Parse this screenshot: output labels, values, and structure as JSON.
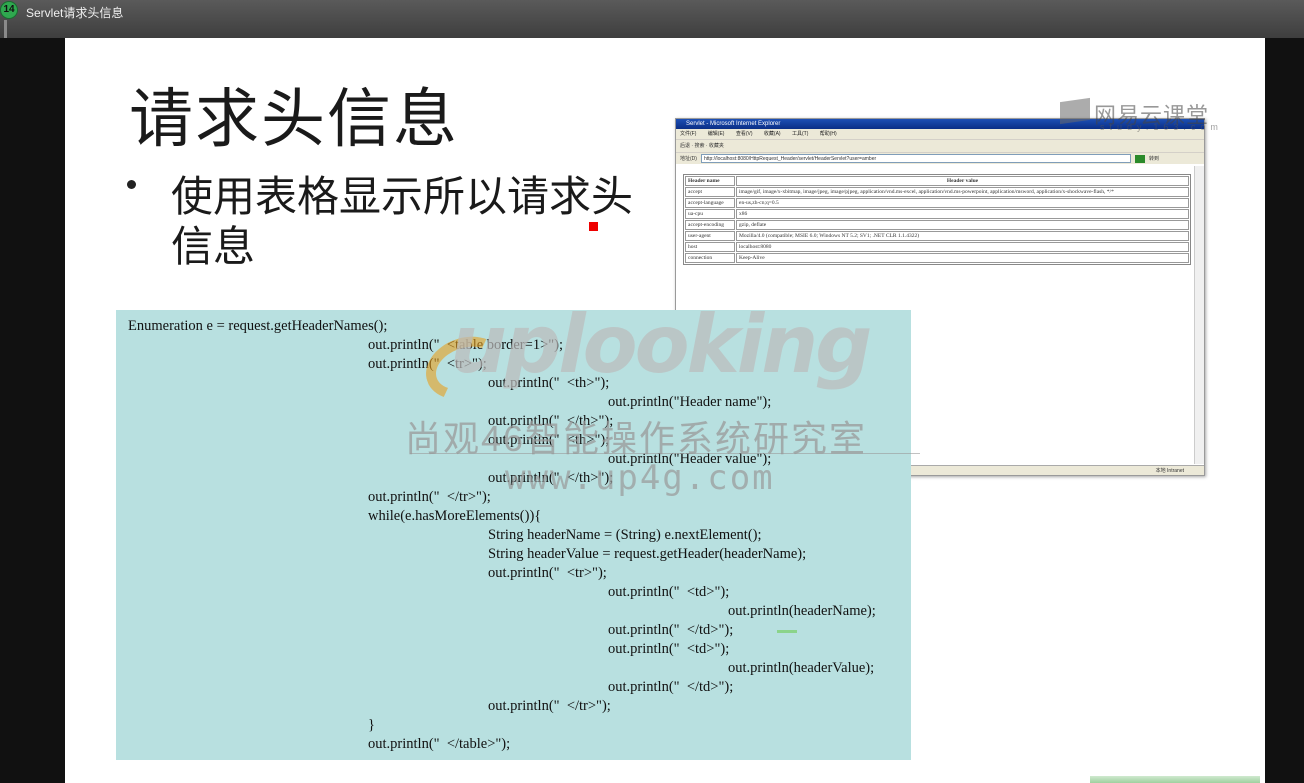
{
  "player": {
    "badge": "14",
    "title": "Servlet请求头信息"
  },
  "slide": {
    "title": "请求头信息",
    "bullet": "使用表格显示所以请求头信息"
  },
  "browser": {
    "title": "Servlet - Microsoft Internet Explorer",
    "menu": [
      "文件(F)",
      "编辑(E)",
      "查看(V)",
      "收藏(A)",
      "工具(T)",
      "帮助(H)"
    ],
    "toolbar": "后退 · 搜索 · 收藏夹",
    "address_label": "地址(D)",
    "address": "http://localhost:8080/HttpRequest_Header/servlet/HeaderServlet?user=amber",
    "go_label": "转到",
    "status": "本地 Intranet",
    "table": {
      "headers": [
        "Header name",
        "Header value"
      ],
      "rows": [
        [
          "accept",
          "image/gif, image/x-xbitmap, image/jpeg, image/pjpeg, application/vnd.ms-excel, application/vnd.ms-powerpoint, application/msword, application/x-shockwave-flash, */*"
        ],
        [
          "accept-language",
          "en-us,zh-cn;q=0.5"
        ],
        [
          "ua-cpu",
          "x86"
        ],
        [
          "accept-encoding",
          "gzip, deflate"
        ],
        [
          "user-agent",
          "Mozilla/4.0 (compatible; MSIE 6.0; Windows NT 5.2; SV1; .NET CLR 1.1.4322)"
        ],
        [
          "host",
          "localhost:8080"
        ],
        [
          "connection",
          "Keep-Alive"
        ]
      ]
    }
  },
  "watermark": {
    "logo_text": "网易云课堂",
    "logo_sub": "study.163.com",
    "brand": "uplooking",
    "brand_cn": "尚观46智能操作系统研究室",
    "url": "www.up4g.com"
  },
  "code": [
    "Enumeration e = request.getHeaderNames();",
    "out.println(\"  <table border=1>\");",
    "out.println(\"  <tr>\");",
    "out.println(\"  <th>\");",
    "out.println(\"Header name\");",
    "out.println(\"  </th>\");",
    "out.println(\"  <th>\");",
    "out.println(\"Header value\");",
    "out.println(\"  </th>\");",
    "out.println(\"  </tr>\");",
    "while(e.hasMoreElements()){",
    "String headerName = (String) e.nextElement();",
    "String headerValue = request.getHeader(headerName);",
    "out.println(\"  <tr>\");",
    "out.println(\"  <td>\");",
    "out.println(headerName);",
    "out.println(\"  </td>\");",
    "out.println(\"  <td>\");",
    "out.println(headerValue);",
    "out.println(\"  </td>\");",
    "out.println(\"  </tr>\");",
    "}",
    "out.println(\"  </table>\");"
  ]
}
